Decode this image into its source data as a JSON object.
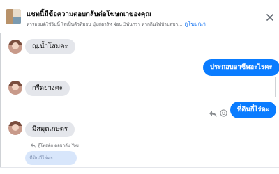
{
  "banner": {
    "title": "แชทนี้มีข้อความตอบกลับต่อโฆษณาของคุณ",
    "subtitle": "หารอยนต์ใช้วินนี้ ไล่เป็นตัวที่มอบ ปุ่มสตาร์ท ผ่อน 3พันกว่า หากกินไฟบ้านสบา...",
    "link": "ดูโฆษณา"
  },
  "messages": [
    {
      "side": "in",
      "text": "ญ.น้ำโสมคะ"
    },
    {
      "side": "out",
      "text": "ประกอบอาชีพอะไรคะ"
    },
    {
      "side": "in",
      "text": "กรีดยางคะ"
    },
    {
      "side": "out",
      "text": "ที่ดินกี่ไร่คะ"
    },
    {
      "side": "in",
      "text": "มีสมุดเกษตร"
    }
  ],
  "reply_note": "ตู้โพสต์ก ตอบกลับ You",
  "quoted_text": "ที่ดินกี่ไร่คะ",
  "icons": {
    "close": "close-icon",
    "reply": "reply-icon",
    "react": "emoji-icon"
  },
  "colors": {
    "accent": "#0a7cff",
    "link": "#1876f2",
    "incoming_bubble": "#e4e6eb"
  }
}
